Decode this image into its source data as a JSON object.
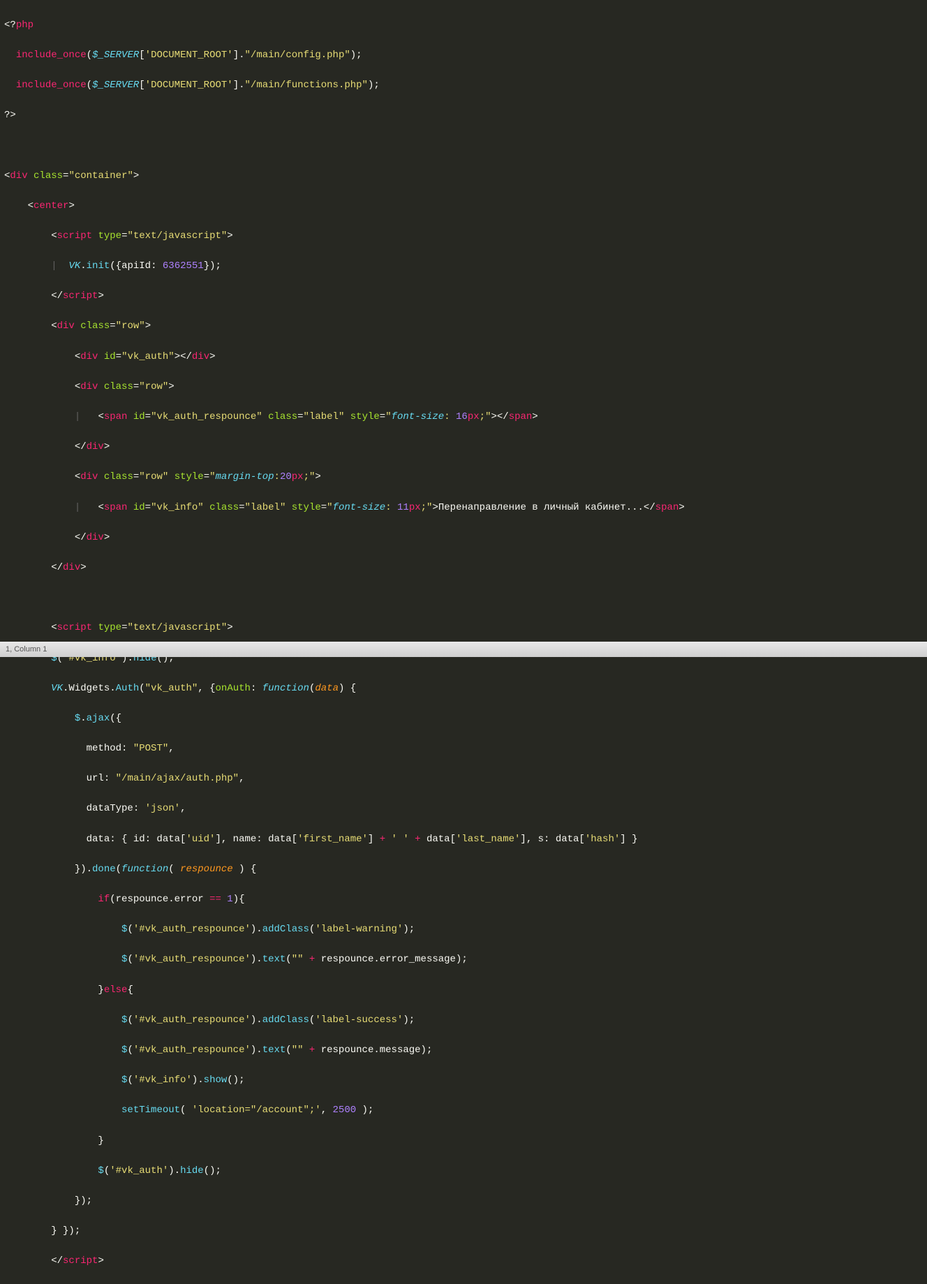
{
  "statusbar": {
    "text": "1, Column 1"
  },
  "code": {
    "l1": {
      "a": "<?",
      "b": "php"
    },
    "l2": {
      "a": "  ",
      "b": "include_once",
      "c": "(",
      "d": "$_SERVER",
      "e": "[",
      "f": "'DOCUMENT_ROOT'",
      "g": "].",
      "h": "\"/main/config.php\"",
      "i": ");"
    },
    "l3": {
      "a": "  ",
      "b": "include_once",
      "c": "(",
      "d": "$_SERVER",
      "e": "[",
      "f": "'DOCUMENT_ROOT'",
      "g": "].",
      "h": "\"/main/functions.php\"",
      "i": ");"
    },
    "l4": {
      "a": "?>"
    },
    "l5": {
      "a": ""
    },
    "l6": {
      "a": "<",
      "b": "div",
      "c": " ",
      "d": "class",
      "e": "=",
      "f": "\"container\"",
      "g": ">"
    },
    "l7": {
      "a": "    <",
      "b": "center",
      "c": ">"
    },
    "l8": {
      "a": "        <",
      "b": "script",
      "c": " ",
      "d": "type",
      "e": "=",
      "f": "\"text/javascript\"",
      "g": ">"
    },
    "l9": {
      "a": "        ",
      "b": "|",
      "c": "  ",
      "d": "VK",
      "e": ".",
      "f": "init",
      "g": "({apiId: ",
      "h": "6362551",
      "i": "});"
    },
    "l10": {
      "a": "        </",
      "b": "script",
      "c": ">"
    },
    "l11": {
      "a": "        <",
      "b": "div",
      "c": " ",
      "d": "class",
      "e": "=",
      "f": "\"row\"",
      "g": ">"
    },
    "l12": {
      "a": "            <",
      "b": "div",
      "c": " ",
      "d": "id",
      "e": "=",
      "f": "\"vk_auth\"",
      "g": "></",
      "h": "div",
      "i": ">"
    },
    "l13": {
      "a": "            <",
      "b": "div",
      "c": " ",
      "d": "class",
      "e": "=",
      "f": "\"row\"",
      "g": ">"
    },
    "l14": {
      "a": "            ",
      "b": "|",
      "c": "   <",
      "d": "span",
      "e": " ",
      "f": "id",
      "g": "=",
      "h": "\"vk_auth_respounce\"",
      "i": " ",
      "j": "class",
      "k": "=",
      "l": "\"label\"",
      "m": " ",
      "n": "style",
      "o": "=",
      "p": "\"",
      "q": "font-size",
      "r": ": ",
      "s": "16",
      "t": "px",
      "u": ";",
      "v": "\"",
      "w": "></",
      "x": "span",
      "y": ">"
    },
    "l15": {
      "a": "            </",
      "b": "div",
      "c": ">"
    },
    "l16": {
      "a": "            <",
      "b": "div",
      "c": " ",
      "d": "class",
      "e": "=",
      "f": "\"row\"",
      "g": " ",
      "h": "style",
      "i": "=",
      "j": "\"",
      "k": "margin-top",
      "l": ":",
      "m": "20",
      "n": "px",
      "o": ";",
      "p": "\"",
      "q": ">"
    },
    "l17": {
      "a": "            ",
      "b": "|",
      "c": "   <",
      "d": "span",
      "e": " ",
      "f": "id",
      "g": "=",
      "h": "\"vk_info\"",
      "i": " ",
      "j": "class",
      "k": "=",
      "l": "\"label\"",
      "m": " ",
      "n": "style",
      "o": "=",
      "p": "\"",
      "q": "font-size",
      "r": ": ",
      "s": "11",
      "t": "px",
      "u": ";",
      "v": "\"",
      "w": ">",
      "x": "Перенаправление в личный кабинет...",
      "y": "</",
      "z": "span",
      "aa": ">"
    },
    "l18": {
      "a": "            </",
      "b": "div",
      "c": ">"
    },
    "l19": {
      "a": "        </",
      "b": "div",
      "c": ">"
    },
    "l20": {
      "a": ""
    },
    "l21": {
      "a": "        <",
      "b": "script",
      "c": " ",
      "d": "type",
      "e": "=",
      "f": "\"text/javascript\"",
      "g": ">"
    },
    "l22": {
      "a": "        ",
      "b": "$",
      "c": "(",
      "d": "'#vk_info'",
      "e": ").",
      "f": "hide",
      "g": "();"
    },
    "l23": {
      "a": "        ",
      "b": "VK",
      "c": ".Widgets.",
      "d": "Auth",
      "e": "(",
      "f": "\"vk_auth\"",
      "g": ", {",
      "h": "onAuth",
      "i": ": ",
      "j": "function",
      "k": "(",
      "l": "data",
      "m": ") {"
    },
    "l24": {
      "a": "            ",
      "b": "$",
      "c": ".",
      "d": "ajax",
      "e": "({"
    },
    "l25": {
      "a": "              method: ",
      "b": "\"POST\"",
      "c": ","
    },
    "l26": {
      "a": "              url: ",
      "b": "\"/main/ajax/auth.php\"",
      "c": ","
    },
    "l27": {
      "a": "              dataType: ",
      "b": "'json'",
      "c": ","
    },
    "l28": {
      "a": "              data: { id: data[",
      "b": "'uid'",
      "c": "], name: data[",
      "d": "'first_name'",
      "e": "] ",
      "f": "+",
      "g": " ",
      "h": "' '",
      "i": " ",
      "j": "+",
      "k": " data[",
      "l": "'last_name'",
      "m": "], s: data[",
      "n": "'hash'",
      "o": "] }"
    },
    "l29": {
      "a": "            }).",
      "b": "done",
      "c": "(",
      "d": "function",
      "e": "( ",
      "f": "respounce",
      "g": " ) {"
    },
    "l30": {
      "a": "                ",
      "b": "if",
      "c": "(respounce.error ",
      "d": "==",
      "e": " ",
      "f": "1",
      "g": "){"
    },
    "l31": {
      "a": "                    ",
      "b": "$",
      "c": "(",
      "d": "'#vk_auth_respounce'",
      "e": ").",
      "f": "addClass",
      "g": "(",
      "h": "'label-warning'",
      "i": ");"
    },
    "l32": {
      "a": "                    ",
      "b": "$",
      "c": "(",
      "d": "'#vk_auth_respounce'",
      "e": ").",
      "f": "text",
      "g": "(",
      "h": "\"\"",
      "i": " ",
      "j": "+",
      "k": " respounce.error_message);"
    },
    "l33": {
      "a": "                }",
      "b": "else",
      "c": "{"
    },
    "l34": {
      "a": "                    ",
      "b": "$",
      "c": "(",
      "d": "'#vk_auth_respounce'",
      "e": ").",
      "f": "addClass",
      "g": "(",
      "h": "'label-success'",
      "i": ");"
    },
    "l35": {
      "a": "                    ",
      "b": "$",
      "c": "(",
      "d": "'#vk_auth_respounce'",
      "e": ").",
      "f": "text",
      "g": "(",
      "h": "\"\"",
      "i": " ",
      "j": "+",
      "k": " respounce.message);"
    },
    "l36": {
      "a": "                    ",
      "b": "$",
      "c": "(",
      "d": "'#vk_info'",
      "e": ").",
      "f": "show",
      "g": "();"
    },
    "l37": {
      "a": "                    ",
      "b": "setTimeout",
      "c": "( ",
      "d": "'location=\"/account\";'",
      "e": ", ",
      "f": "2500",
      "g": " );"
    },
    "l38": {
      "a": "                }"
    },
    "l39": {
      "a": "                ",
      "b": "$",
      "c": "(",
      "d": "'#vk_auth'",
      "e": ").",
      "f": "hide",
      "g": "();"
    },
    "l40": {
      "a": "            });"
    },
    "l41": {
      "a": "        } });"
    },
    "l42": {
      "a": "        </",
      "b": "script",
      "c": ">"
    }
  }
}
